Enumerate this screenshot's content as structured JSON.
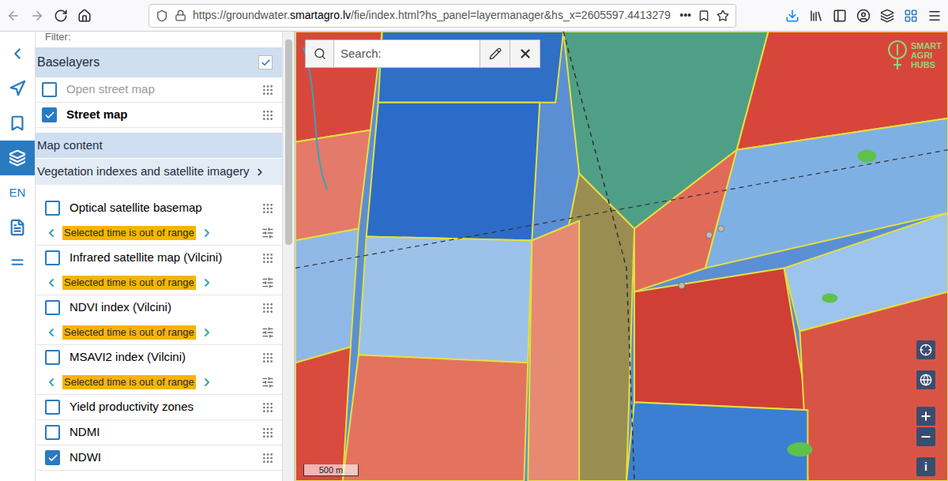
{
  "browser": {
    "url": {
      "prefix": "https://groundwater.",
      "domain": "smartagro.lv",
      "suffix": "/fie/index.html?hs_panel=layermanager&hs_x=2605597.4413279"
    },
    "overflow": "•••"
  },
  "sidebar": {
    "items": [
      {
        "kind": "icon",
        "selected": false
      },
      {
        "kind": "icon",
        "selected": false
      },
      {
        "kind": "icon",
        "selected": false
      },
      {
        "kind": "icon",
        "selected": true
      },
      {
        "kind": "text",
        "label": "EN",
        "selected": false
      },
      {
        "kind": "icon",
        "selected": false
      },
      {
        "kind": "icon",
        "selected": false
      }
    ]
  },
  "panel": {
    "filter_label": "Filter:",
    "baselayers": {
      "title": "Baselayers",
      "checked": true,
      "items": [
        {
          "label": "Open street map",
          "checked": false,
          "disabled": true
        },
        {
          "label": "Street map",
          "checked": true,
          "disabled": false
        }
      ]
    },
    "map_content_title": "Map content",
    "folder": {
      "title": "Vegetation indexes and satellite imagery",
      "expanded": true
    },
    "layers": [
      {
        "kind": "timed",
        "label": "Optical satellite basemap",
        "checked": false,
        "time_status": "Selected time is out of range"
      },
      {
        "kind": "timed",
        "label": "Infrared satellite map (Vilcini)",
        "checked": false,
        "time_status": "Selected time is out of range"
      },
      {
        "kind": "timed",
        "label": "NDVI index (Vilcini)",
        "checked": false,
        "time_status": "Selected time is out of range"
      },
      {
        "kind": "timed",
        "label": "MSAVI2 index (Vilcini)",
        "checked": false,
        "time_status": "Selected time is out of range"
      },
      {
        "kind": "plain",
        "label": "Yield productivity zones",
        "checked": false
      },
      {
        "kind": "plain",
        "label": "NDMI",
        "checked": false
      },
      {
        "kind": "plain",
        "label": "NDWI",
        "checked": true
      }
    ]
  },
  "map": {
    "search": {
      "placeholder": "Search:"
    },
    "logo": [
      "SMART",
      "AGRI",
      "HUBS"
    ],
    "scale": "500 m",
    "info": "i"
  }
}
